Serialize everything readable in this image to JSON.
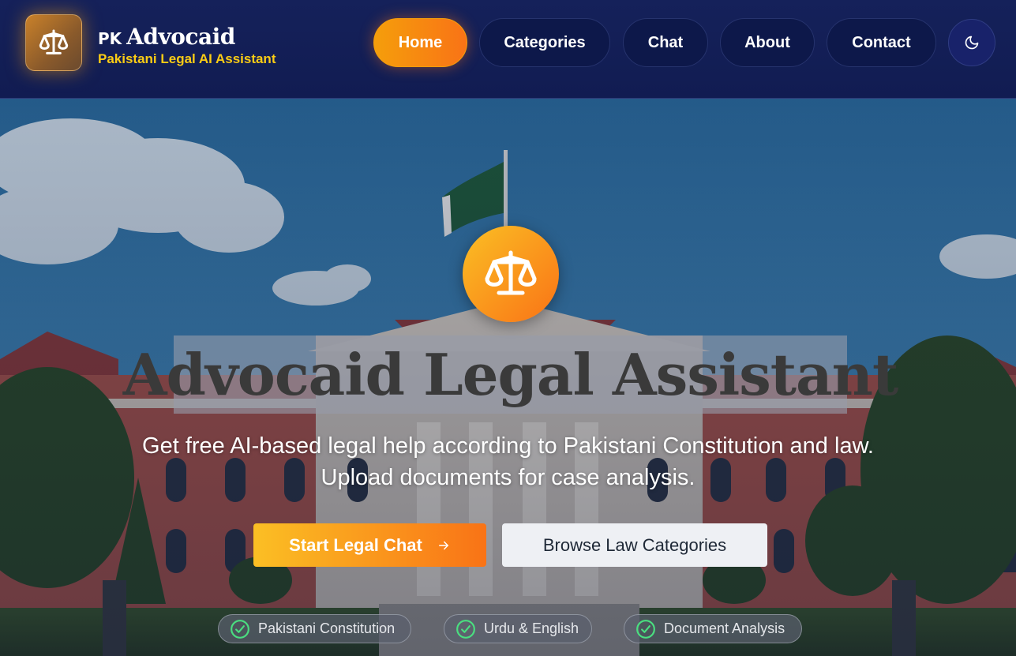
{
  "header": {
    "brand_pk": "PK",
    "brand_name": "Advocaid",
    "brand_subtitle": "Pakistani Legal AI Assistant",
    "nav": [
      {
        "label": "Home",
        "active": true
      },
      {
        "label": "Categories",
        "active": false
      },
      {
        "label": "Chat",
        "active": false
      },
      {
        "label": "About",
        "active": false
      },
      {
        "label": "Contact",
        "active": false
      }
    ],
    "theme_toggle_icon": "moon-icon"
  },
  "hero": {
    "emblem_icon": "scales-of-justice-icon",
    "title": "Advocaid Legal Assistant",
    "description_line1": "Get free AI-based legal help according to Pakistani Constitution and law.",
    "description_line2": "Upload documents for case analysis.",
    "primary_cta": "Start Legal Chat",
    "primary_cta_icon": "arrow-right-icon",
    "secondary_cta": "Browse Law Categories",
    "features": [
      {
        "label": "Pakistani Constitution",
        "icon": "check-circle-icon"
      },
      {
        "label": "Urdu & English",
        "icon": "check-circle-icon"
      },
      {
        "label": "Document Analysis",
        "icon": "check-circle-icon"
      }
    ]
  },
  "colors": {
    "header_bg": "#111c52",
    "accent_orange": "#f97316",
    "accent_amber": "#fbbf24",
    "subtitle_yellow": "#facc15",
    "check_green": "#4ade80"
  }
}
